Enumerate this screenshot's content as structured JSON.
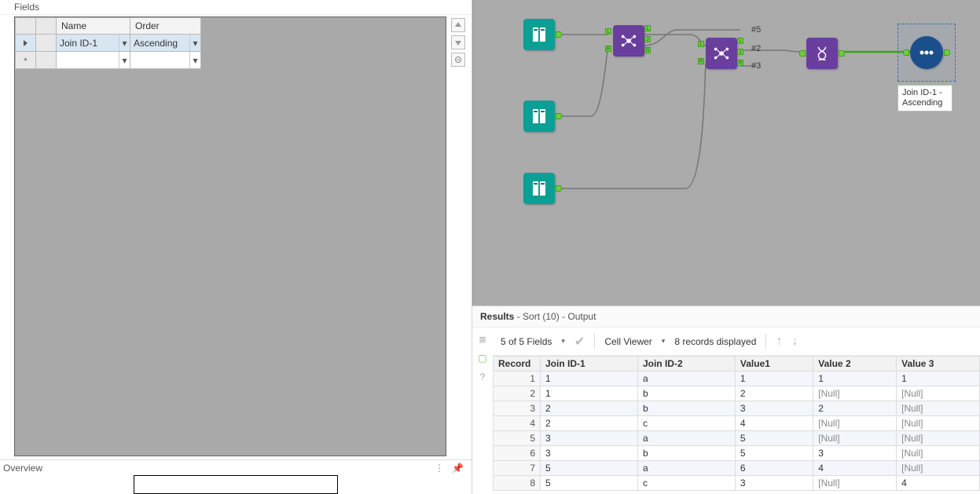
{
  "config": {
    "title": "Fields",
    "columns": {
      "name": "Name",
      "order": "Order"
    },
    "rows": [
      {
        "name": "Join ID-1",
        "order": "Ascending",
        "selected": true
      },
      {
        "name": "",
        "order": "",
        "selected": false
      }
    ]
  },
  "overview": {
    "label": "Overview"
  },
  "canvas": {
    "annotations": {
      "a1": "#5",
      "a2": "#2",
      "a3": "#3"
    },
    "selected_tool_caption": "Join ID-1 - Ascending"
  },
  "results": {
    "title": "Results",
    "subtitle": "- Sort (10) - Output",
    "fields_count_text": "5 of 5 Fields",
    "cell_viewer_label": "Cell Viewer",
    "records_displayed_text": "8 records displayed",
    "columns": [
      "Record",
      "Join ID-1",
      "Join ID-2",
      "Value1",
      "Value 2",
      "Value 3"
    ],
    "rows": [
      {
        "rec": 1,
        "c": [
          "1",
          "a",
          "1",
          "1",
          "1"
        ]
      },
      {
        "rec": 2,
        "c": [
          "1",
          "b",
          "2",
          "[Null]",
          "[Null]"
        ]
      },
      {
        "rec": 3,
        "c": [
          "2",
          "b",
          "3",
          "2",
          "[Null]"
        ]
      },
      {
        "rec": 4,
        "c": [
          "2",
          "c",
          "4",
          "[Null]",
          "[Null]"
        ]
      },
      {
        "rec": 5,
        "c": [
          "3",
          "a",
          "5",
          "[Null]",
          "[Null]"
        ]
      },
      {
        "rec": 6,
        "c": [
          "3",
          "b",
          "5",
          "3",
          "[Null]"
        ]
      },
      {
        "rec": 7,
        "c": [
          "5",
          "a",
          "6",
          "4",
          "[Null]"
        ]
      },
      {
        "rec": 8,
        "c": [
          "5",
          "c",
          "3",
          "[Null]",
          "4"
        ]
      }
    ]
  }
}
